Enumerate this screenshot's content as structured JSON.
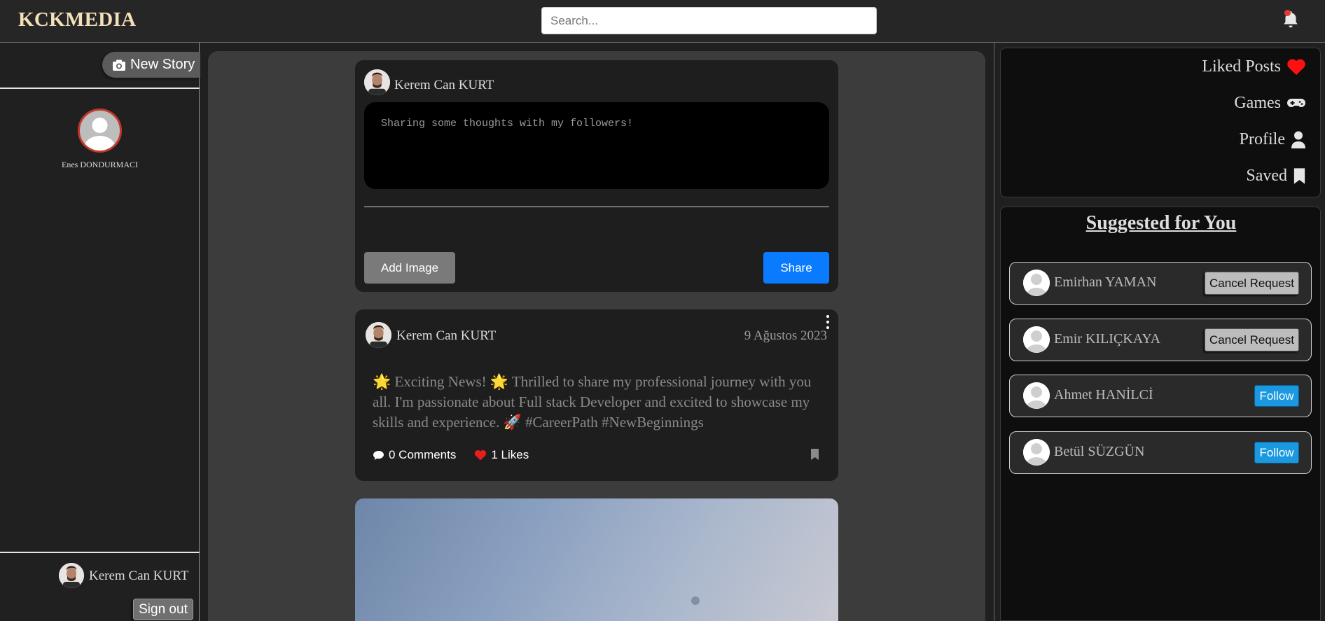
{
  "header": {
    "logo": "KCKMEDIA",
    "search_placeholder": "Search..."
  },
  "left": {
    "new_story_label": "New Story",
    "story_user": "Enes DONDURMACI",
    "current_user": "Kerem Can KURT",
    "sign_out_label": "Sign out"
  },
  "composer": {
    "author": "Kerem Can KURT",
    "placeholder": "Sharing some thoughts with my followers!",
    "add_image_label": "Add Image",
    "share_label": "Share"
  },
  "post": {
    "author": "Kerem Can KURT",
    "date": "9 Ağustos 2023",
    "text": "🌟 Exciting News! 🌟 Thrilled to share my professional journey with you all. I'm passionate about Full stack Developer and excited to showcase my skills and experience. 🚀 #CareerPath #NewBeginnings",
    "comments": "0 Comments",
    "likes": "1 Likes"
  },
  "menu": [
    {
      "label": "Liked Posts",
      "icon": "heart-icon"
    },
    {
      "label": "Games",
      "icon": "gamepad-icon"
    },
    {
      "label": "Profile",
      "icon": "user-icon"
    },
    {
      "label": "Saved",
      "icon": "bookmark-icon"
    }
  ],
  "suggestions": {
    "title": "Suggested for You",
    "items": [
      {
        "name": "Emirhan YAMAN",
        "action": "Cancel Request"
      },
      {
        "name": "Emir KILIÇKAYA",
        "action": "Cancel Request"
      },
      {
        "name": "Ahmet HANİLCİ",
        "action": "Follow"
      },
      {
        "name": "Betül SÜZGÜN",
        "action": "Follow"
      }
    ]
  },
  "colors": {
    "accent_blue": "#0a7bff",
    "follow_blue": "#1a98e0",
    "like_red": "#e61e1e",
    "logo": "#f3dfb8"
  }
}
